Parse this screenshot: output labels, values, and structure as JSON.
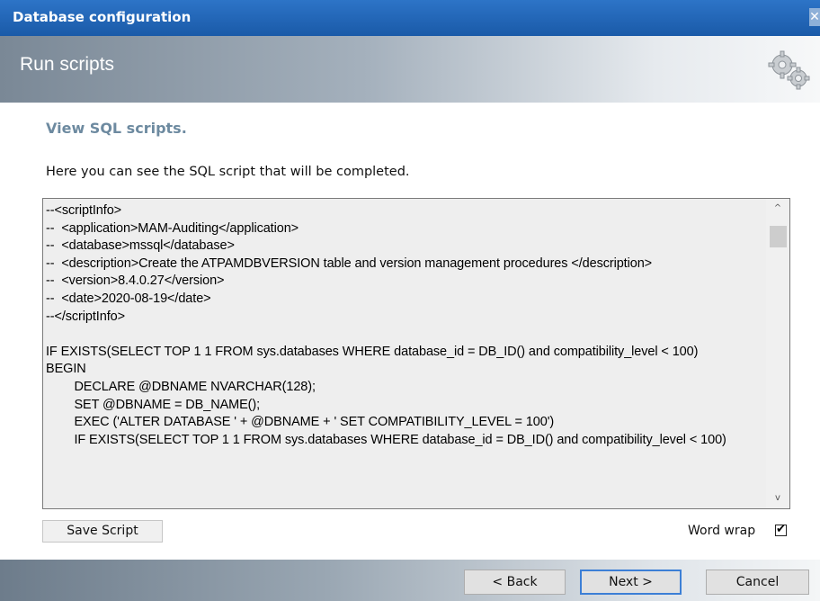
{
  "window": {
    "title": "Database configuration",
    "close_glyph": "✕"
  },
  "header": {
    "title": "Run scripts",
    "icon": "gears-icon"
  },
  "section": {
    "title": "View SQL scripts.",
    "description": "Here you can see the SQL script that will be completed."
  },
  "script": {
    "text": "--<scriptInfo>\n--  <application>MAM-Auditing</application>\n--  <database>mssql</database>\n--  <description>Create the ATPAMDBVERSION table and version management procedures </description>\n--  <version>8.4.0.27</version>\n--  <date>2020-08-19</date>\n--</scriptInfo>\n\nIF EXISTS(SELECT TOP 1 1 FROM sys.databases WHERE database_id = DB_ID() and compatibility_level < 100)\nBEGIN\n\tDECLARE @DBNAME NVARCHAR(128);\n\tSET @DBNAME = DB_NAME();\n\tEXEC ('ALTER DATABASE ' + @DBNAME + ' SET COMPATIBILITY_LEVEL = 100')\n\tIF EXISTS(SELECT TOP 1 1 FROM sys.databases WHERE database_id = DB_ID() and compatibility_level < 100)",
    "scroll_up": "^",
    "scroll_down": "v"
  },
  "actions": {
    "save_script": "Save Script",
    "word_wrap_label": "Word wrap",
    "word_wrap_checked": true,
    "check_glyph": "✔"
  },
  "nav": {
    "back": "< Back",
    "next": "Next >",
    "cancel": "Cancel"
  }
}
